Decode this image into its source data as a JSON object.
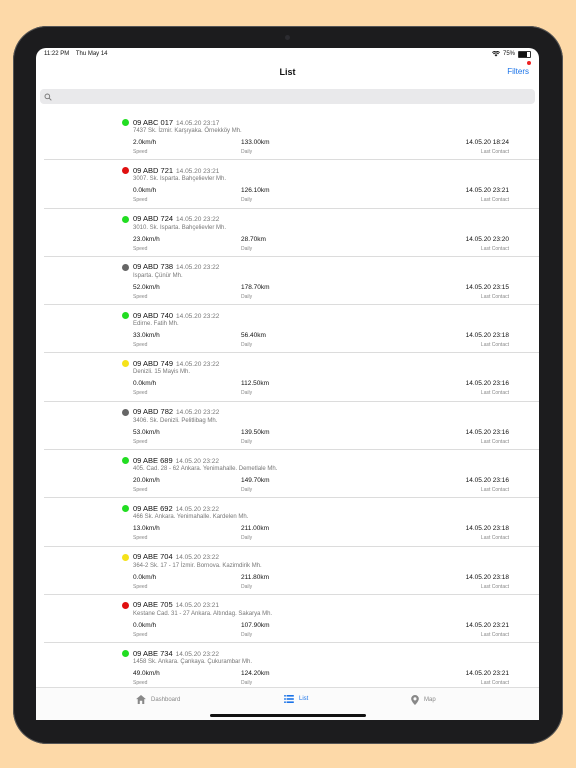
{
  "status": {
    "time": "11:22 PM",
    "date": "Thu May 14",
    "battery": "75%",
    "battery_level": 0.75
  },
  "nav": {
    "title": "List",
    "filters_label": "Filters"
  },
  "search": {
    "placeholder": ""
  },
  "labels": {
    "speed": "Speed",
    "daily": "Daily",
    "last_contact": "Last Contact"
  },
  "vehicles": [
    {
      "plate": "09 ABC 017",
      "timestamp": "14.05.20 23:17",
      "address": "7437 Sk. İzmir. Karşıyaka. Örnekköy Mh.",
      "speed": "2.0km/h",
      "daily": "133.00km",
      "last_contact": "14.05.20 18:24",
      "status_color": "#22dd22"
    },
    {
      "plate": "09 ABD 721",
      "timestamp": "14.05.20 23:21",
      "address": "3007. Sk. Isparta. Bahçelievler Mh.",
      "speed": "0.0km/h",
      "daily": "126.10km",
      "last_contact": "14.05.20 23:21",
      "status_color": "#e01010"
    },
    {
      "plate": "09 ABD 724",
      "timestamp": "14.05.20 23:22",
      "address": "3010. Sk. Isparta. Bahçelievler Mh.",
      "speed": "23.0km/h",
      "daily": "28.70km",
      "last_contact": "14.05.20 23:20",
      "status_color": "#22dd22"
    },
    {
      "plate": "09 ABD 738",
      "timestamp": "14.05.20 23:22",
      "address": "Isparta. Çünür Mh.",
      "speed": "52.0km/h",
      "daily": "178.70km",
      "last_contact": "14.05.20 23:15",
      "status_color": "#666666"
    },
    {
      "plate": "09 ABD 740",
      "timestamp": "14.05.20 23:22",
      "address": "Edirne. Fatih Mh.",
      "speed": "33.0km/h",
      "daily": "56.40km",
      "last_contact": "14.05.20 23:18",
      "status_color": "#22dd22"
    },
    {
      "plate": "09 ABD 749",
      "timestamp": "14.05.20 23:22",
      "address": "Denizli. 15 Mayis Mh.",
      "speed": "0.0km/h",
      "daily": "112.50km",
      "last_contact": "14.05.20 23:16",
      "status_color": "#f5e21a"
    },
    {
      "plate": "09 ABD 782",
      "timestamp": "14.05.20 23:22",
      "address": "3406. Sk. Denizli. Pelitlibag Mh.",
      "speed": "53.0km/h",
      "daily": "139.50km",
      "last_contact": "14.05.20 23:16",
      "status_color": "#666666"
    },
    {
      "plate": "09 ABE 689",
      "timestamp": "14.05.20 23:22",
      "address": "405. Cad. 28 - 62 Ankara. Yenimahalle. Demetlale Mh.",
      "speed": "20.0km/h",
      "daily": "149.70km",
      "last_contact": "14.05.20 23:16",
      "status_color": "#22dd22"
    },
    {
      "plate": "09 ABE 692",
      "timestamp": "14.05.20 23:22",
      "address": "466 Sk. Ankara. Yenimahalle. Kardelen Mh.",
      "speed": "13.0km/h",
      "daily": "211.00km",
      "last_contact": "14.05.20 23:18",
      "status_color": "#22dd22"
    },
    {
      "plate": "09 ABE 704",
      "timestamp": "14.05.20 23:22",
      "address": "364-2 Sk. 17 - 17 İzmir. Bornova. Kazimdirik Mh.",
      "speed": "0.0km/h",
      "daily": "211.80km",
      "last_contact": "14.05.20 23:18",
      "status_color": "#f5e21a"
    },
    {
      "plate": "09 ABE 705",
      "timestamp": "14.05.20 23:21",
      "address": "Kestane Cad. 31 - 27 Ankara. Altındag. Sakarya Mh.",
      "speed": "0.0km/h",
      "daily": "107.90km",
      "last_contact": "14.05.20 23:21",
      "status_color": "#e01010"
    },
    {
      "plate": "09 ABE 734",
      "timestamp": "14.05.20 23:22",
      "address": "1458 Sk. Ankara. Çankaya. Çukurambar Mh.",
      "speed": "49.0km/h",
      "daily": "124.20km",
      "last_contact": "14.05.20 23:21",
      "status_color": "#22dd22"
    }
  ],
  "tabs": {
    "dashboard": "Dashboard",
    "list": "List",
    "map": "Map"
  },
  "colors": {
    "accent": "#1a73e8",
    "background": "#fdd9a8"
  }
}
